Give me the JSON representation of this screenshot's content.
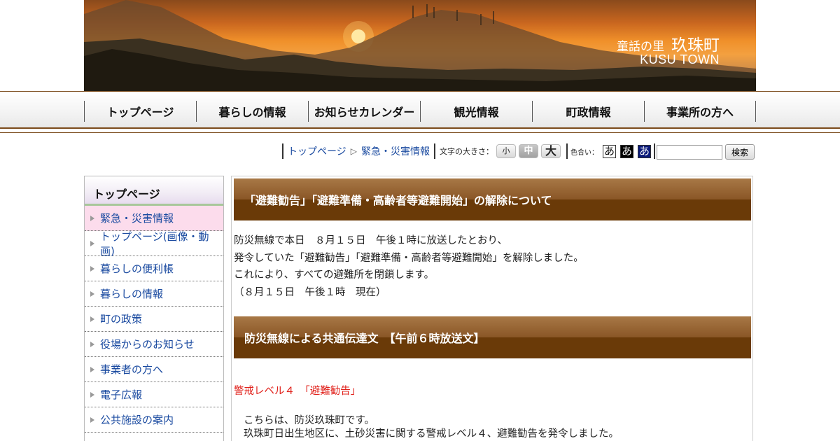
{
  "banner": {
    "subtitle": "童話の里",
    "town": "玖珠町",
    "town_en": "KUSU TOWN"
  },
  "gnav": {
    "items": [
      "トップページ",
      "暮らしの情報",
      "お知らせカレンダー",
      "観光情報",
      "町政情報",
      "事業所の方へ"
    ]
  },
  "breadcrumb": {
    "home": "トップページ",
    "separator": "▷",
    "current": "緊急・災害情報"
  },
  "font_size": {
    "label": "文字の大きさ：",
    "small": "小",
    "medium": "中",
    "large": "大"
  },
  "color_scheme": {
    "label": "色合い：",
    "options": [
      "あ",
      "あ",
      "あ"
    ]
  },
  "search": {
    "value": "",
    "button": "検索"
  },
  "sidebar": {
    "title": "トップページ",
    "items": [
      {
        "label": "緊急・災害情報",
        "active": true
      },
      {
        "label": "トップページ(画像・動画)",
        "active": false
      },
      {
        "label": "暮らしの便利帳",
        "active": false
      },
      {
        "label": "暮らしの情報",
        "active": false
      },
      {
        "label": "町の政策",
        "active": false
      },
      {
        "label": "役場からのお知らせ",
        "active": false
      },
      {
        "label": "事業者の方へ",
        "active": false
      },
      {
        "label": "電子広報",
        "active": false
      },
      {
        "label": "公共施設の案内",
        "active": false
      }
    ]
  },
  "main": {
    "heading1": "「避難勧告」「避難準備・高齢者等避難開始」の解除について",
    "body1": [
      "防災無線で本日　８月１５日　午後１時に放送したとおり、",
      "発令していた「避難勧告」「避難準備・高齢者等避難開始」を解除しました。",
      "これにより、すべての避難所を閉鎖します。",
      "（８月１５日　午後１時　現在）"
    ],
    "heading2": "防災無線による共通伝達文　【午前６時放送文】",
    "warning": "警戒レベル４　「避難勧告」",
    "body2": [
      "こちらは、防災玖珠町です。",
      "玖珠町日出生地区に、土砂災害に関する警戒レベル４、避難勧告を発令しました。"
    ]
  },
  "colors": {
    "heading_bg": "#6a3a08",
    "link": "#1a4aa0",
    "warning": "#e0201a",
    "sidebar_active": "#fcdcec"
  }
}
